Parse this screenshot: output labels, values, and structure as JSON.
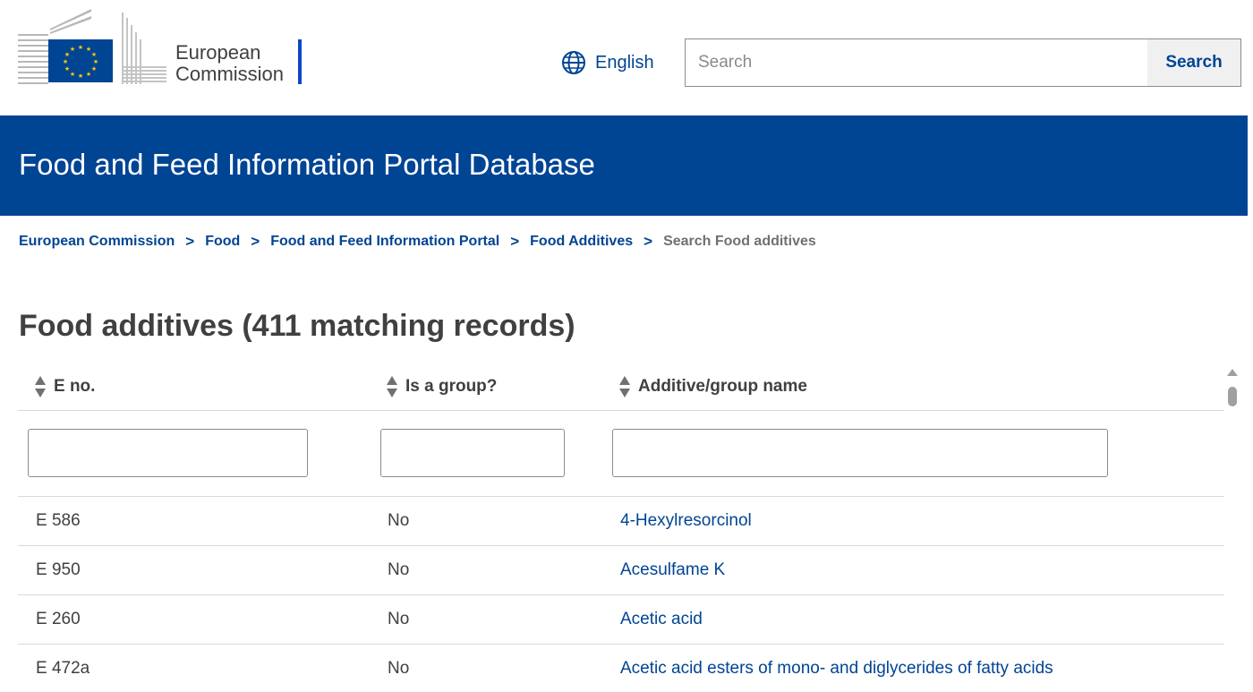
{
  "header": {
    "logo_line1": "European",
    "logo_line2": "Commission",
    "language_label": "English",
    "search_placeholder": "Search",
    "search_button_label": "Search",
    "brand_color": "#004494"
  },
  "banner": {
    "title": "Food and Feed Information Portal Database"
  },
  "breadcrumb": {
    "items": [
      "European Commission",
      "Food",
      "Food and Feed Information Portal",
      "Food Additives"
    ],
    "separator": ">",
    "current": "Search Food additives"
  },
  "page": {
    "title": "Food additives (411 matching records)"
  },
  "table": {
    "headers": [
      "E no.",
      "Is a group?",
      "Additive/group name"
    ],
    "rows": [
      [
        "E 586",
        "No",
        "4-Hexylresorcinol"
      ],
      [
        "E 950",
        "No",
        "Acesulfame K"
      ],
      [
        "E 260",
        "No",
        "Acetic acid"
      ],
      [
        "E 472a",
        "No",
        "Acetic acid esters of mono- and diglycerides of fatty acids"
      ]
    ]
  },
  "icons": {
    "language": "globe-icon",
    "sort": "sort-icon",
    "scroll": "scroll-up-icon"
  }
}
